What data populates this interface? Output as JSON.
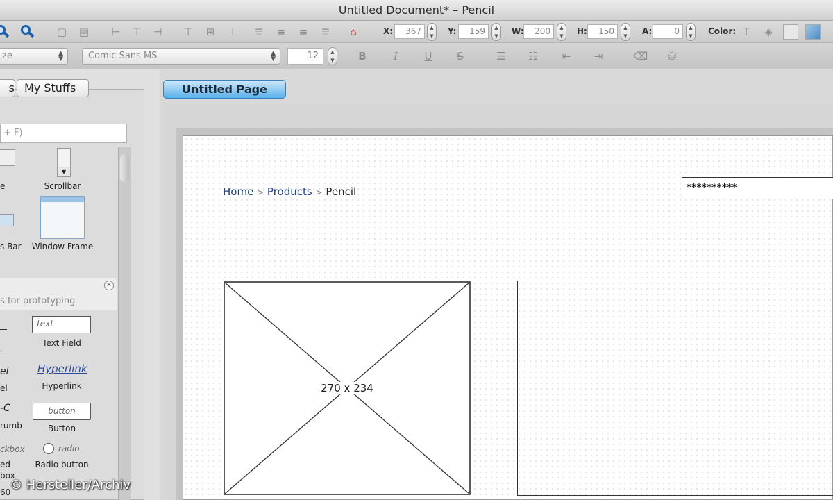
{
  "window": {
    "title": "Untitled Document* – Pencil"
  },
  "toolbar": {
    "x_label": "X:",
    "x_value": "367",
    "y_label": "Y:",
    "y_value": "159",
    "w_label": "W:",
    "w_value": "200",
    "h_label": "H:",
    "h_value": "150",
    "a_label": "A:",
    "a_value": "0",
    "color_label": "Color:"
  },
  "format_bar": {
    "size_select": "ze",
    "font_select": "Comic Sans MS",
    "font_size": "12",
    "bold": "B",
    "italic": "I",
    "underline": "U",
    "strike": "S"
  },
  "left_panel": {
    "tab_partial": "s",
    "tab_my_stuffs": "My Stuffs",
    "search_placeholder": "+ F)",
    "shapes": {
      "cut_label_1": "e",
      "scrollbar": "Scrollbar",
      "cut_label_2": "s Bar",
      "window_frame": "Window Frame"
    },
    "section_title": "s for prototyping",
    "proto": {
      "text_field_sample": "text",
      "text_field": "Text Field",
      "hyperlink_sample": "Hyperlink",
      "hyperlink": "Hyperlink",
      "button_sample": "button",
      "button": "Button",
      "radio_sample": "radio",
      "radio_button": "Radio button",
      "cut_label": "el",
      "cut_label_b": "el",
      "cut_c": "-C",
      "cut_rumb": "rumb",
      "cut_ckbox": "ckbox",
      "cut_ed": "ed",
      "cut_box": "box",
      "cut_60": "60"
    }
  },
  "page_tab": {
    "label": "Untitled Page"
  },
  "canvas": {
    "breadcrumb": {
      "home": "Home",
      "sep": ">",
      "products": "Products",
      "current": "Pencil"
    },
    "password_value": "**********",
    "image_placeholder_dim": "270 x 234"
  },
  "watermark": "© Hersteller/Archiv"
}
